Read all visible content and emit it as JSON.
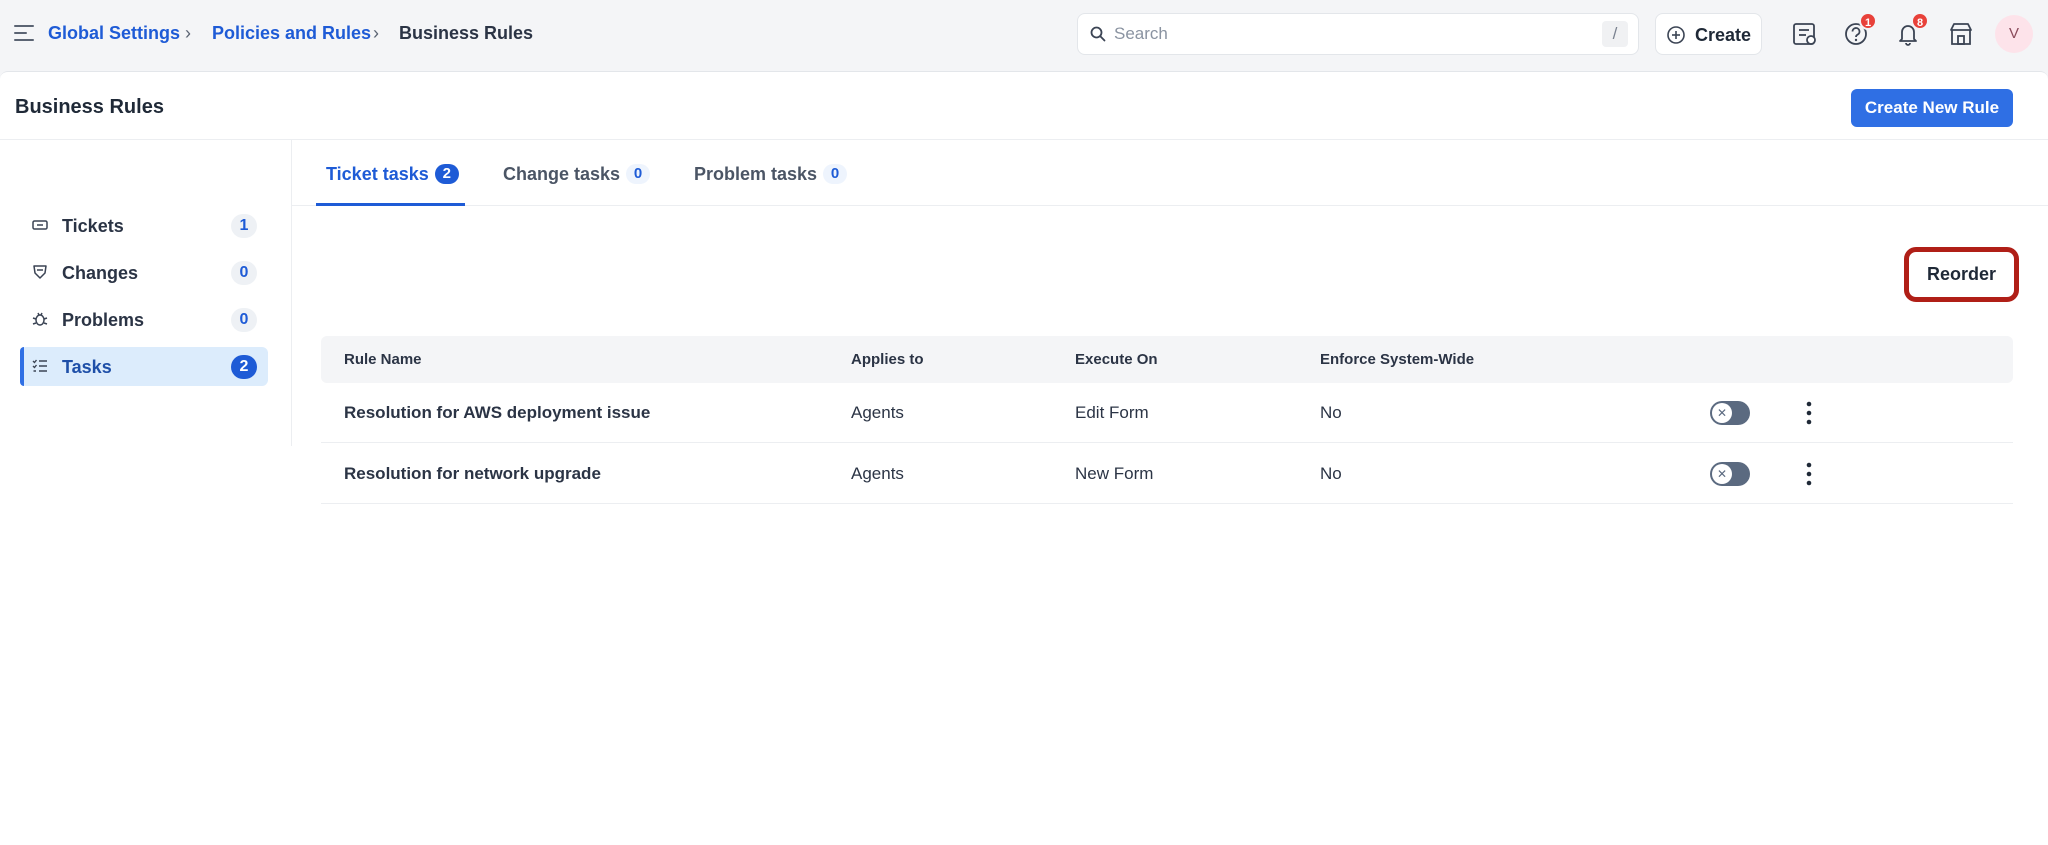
{
  "breadcrumb": {
    "items": [
      "Global Settings",
      "Policies and Rules",
      "Business Rules"
    ],
    "separator": "›"
  },
  "search": {
    "placeholder": "Search",
    "shortcut": "/"
  },
  "header": {
    "create_label": "Create",
    "help_badge": "1",
    "notifications_badge": "8",
    "avatar_initial": "V"
  },
  "page": {
    "title": "Business Rules",
    "create_rule_label": "Create New Rule",
    "reorder_label": "Reorder"
  },
  "sidebar": {
    "items": [
      {
        "label": "Tickets",
        "count": "1",
        "icon": "ticket-icon"
      },
      {
        "label": "Changes",
        "count": "0",
        "icon": "changes-icon"
      },
      {
        "label": "Problems",
        "count": "0",
        "icon": "bug-icon"
      },
      {
        "label": "Tasks",
        "count": "2",
        "icon": "task-list-icon",
        "active": true
      }
    ]
  },
  "tabs": [
    {
      "label": "Ticket tasks",
      "count": "2",
      "active": true
    },
    {
      "label": "Change tasks",
      "count": "0"
    },
    {
      "label": "Problem tasks",
      "count": "0"
    }
  ],
  "table": {
    "columns": [
      "Rule Name",
      "Applies to",
      "Execute On",
      "Enforce System-Wide"
    ],
    "rows": [
      {
        "name": "Resolution for AWS deployment issue",
        "applies_to": "Agents",
        "execute_on": "Edit Form",
        "enforce": "No",
        "enabled": false
      },
      {
        "name": "Resolution for network upgrade",
        "applies_to": "Agents",
        "execute_on": "New Form",
        "enforce": "No",
        "enabled": false
      }
    ]
  },
  "colors": {
    "accent": "#2f6fe4",
    "link": "#1e5bd6",
    "badge": "#e8413a",
    "highlight_outline": "#b01f17"
  }
}
